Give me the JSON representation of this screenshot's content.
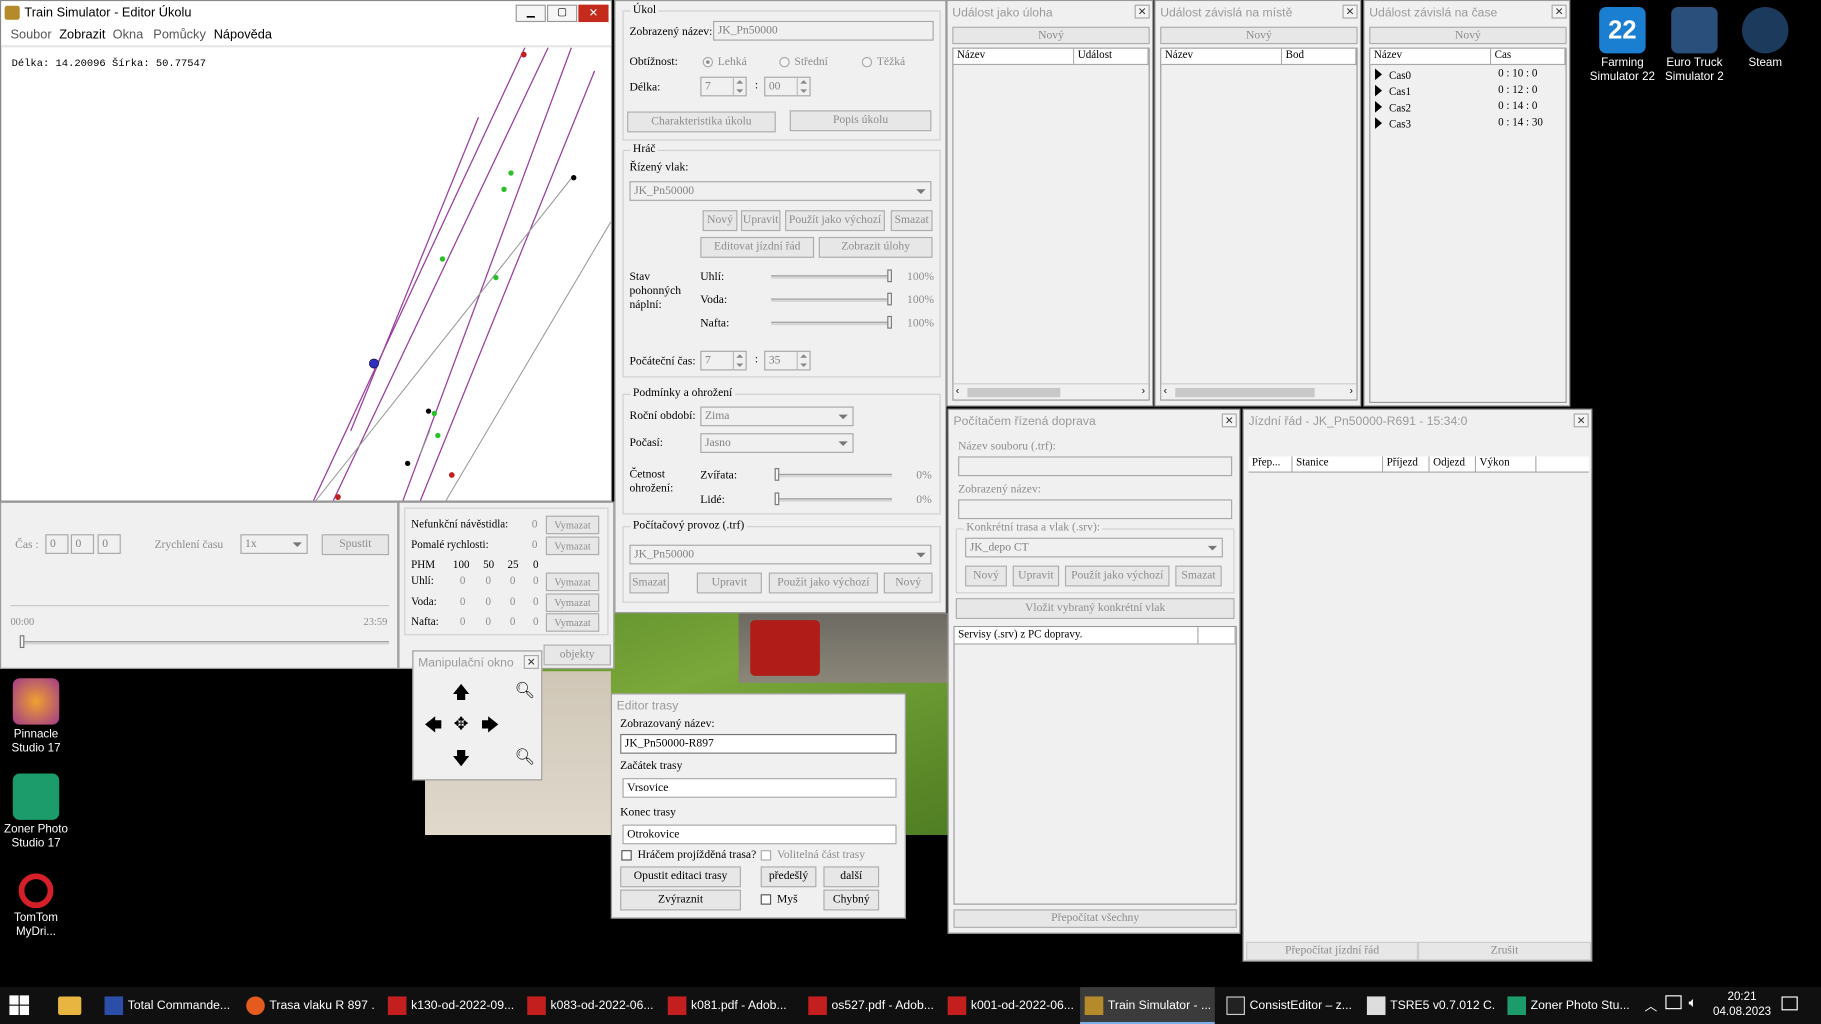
{
  "map_window": {
    "title": "Train Simulator - Editor Úkolu",
    "menu": [
      "Soubor",
      "Zobrazit",
      "Okna",
      "Pomůcky",
      "Nápověda"
    ],
    "coords": "Délka: 14.20096 Šírka: 50.77547"
  },
  "time_panel": {
    "cas_label": "Čas :",
    "h": "0",
    "m": "0",
    "s": "0",
    "zrychleni_label": "Zrychlení času",
    "zrychleni_value": "1x",
    "spustit": "Spustit",
    "t_start": "00:00",
    "t_end": "23:59"
  },
  "stats_panel": {
    "rows": [
      {
        "label": "Nefunkční návěstidla:",
        "vals": [
          "0"
        ],
        "btn": "Vymazat"
      },
      {
        "label": "Pomalé rychlosti:",
        "vals": [
          "0"
        ],
        "btn": "Vymazat"
      },
      {
        "label": "PHM",
        "vals": [
          "100",
          "50",
          "25",
          "0"
        ]
      },
      {
        "label": "Uhlí:",
        "vals": [
          "0",
          "0",
          "0",
          "0"
        ],
        "btn": "Vymazat"
      },
      {
        "label": "Voda:",
        "vals": [
          "0",
          "0",
          "0",
          "0"
        ],
        "btn": "Vymazat"
      },
      {
        "label": "Nafta:",
        "vals": [
          "0",
          "0",
          "0",
          "0"
        ],
        "btn": "Vymazat"
      }
    ],
    "objekty": "objekty"
  },
  "manip": {
    "title": "Manipulační okno"
  },
  "ukol": {
    "group": "Úkol",
    "zobr_label": "Zobrazený název:",
    "zobr_value": "JK_Pn50000",
    "obtiznost_label": "Obtížnost:",
    "obtiznost": [
      "Lehká",
      "Střední",
      "Těžká"
    ],
    "delka_label": "Délka:",
    "delka_h": "7",
    "delka_m": "00",
    "btn_char": "Charakteristika úkolu",
    "btn_popis": "Popis úkolu",
    "hrac_group": "Hráč",
    "rizeny_label": "Řízený vlak:",
    "rizeny_value": "JK_Pn50000",
    "btns1": [
      "Nový",
      "Upravit",
      "Použít jako výchozí",
      "Smazat"
    ],
    "btn_jr": "Editovat jízdní řád",
    "btn_ulohy": "Zobrazit úlohy",
    "stav_label": "Stav pohonných náplní:",
    "napln": [
      {
        "label": "Uhlí:",
        "value": "100%",
        "level": 1.0
      },
      {
        "label": "Voda:",
        "value": "100%",
        "level": 1.0
      },
      {
        "label": "Nafta:",
        "value": "100%",
        "level": 1.0
      }
    ],
    "pocatecni_label": "Počáteční čas:",
    "poc_h": "7",
    "poc_m": "35",
    "podminky_group": "Podmínky a ohrožení",
    "rocni_label": "Roční období:",
    "rocni_value": "Zima",
    "pocasi_label": "Počasí:",
    "pocasi_value": "Jasno",
    "cetnost_label": "Četnost ohrožení:",
    "ohrozeni": [
      {
        "label": "Zvířata:",
        "value": "0%",
        "level": 0
      },
      {
        "label": "Lidé:",
        "value": "0%",
        "level": 0
      }
    ],
    "provoz_group": "Počítačový provoz (.trf)",
    "provoz_value": "JK_Pn50000",
    "btns2": [
      "Smazat",
      "Upravit",
      "Použít jako výchozí",
      "Nový"
    ]
  },
  "uloha": {
    "title": "Událost jako úloha",
    "novy": "Nový",
    "cols": [
      "Název",
      "Událost"
    ]
  },
  "misto": {
    "title": "Událost závislá na místě",
    "novy": "Nový",
    "cols": [
      "Název",
      "Bod"
    ]
  },
  "cas": {
    "title": "Událost závislá na čase",
    "novy": "Nový",
    "cols": [
      "Název",
      "Cas"
    ],
    "rows": [
      {
        "name": "Cas0",
        "time": "0 : 10 : 0"
      },
      {
        "name": "Cas1",
        "time": "0 : 12 : 0"
      },
      {
        "name": "Cas2",
        "time": "0 : 14 : 0"
      },
      {
        "name": "Cas3",
        "time": "0 : 14 : 30"
      }
    ]
  },
  "pcd": {
    "title": "Počítačem řízená doprava",
    "soubor_label": "Název souboru (.trf):",
    "zobr_label": "Zobrazený název:",
    "konkretni_group": "Konkrétní trasa a vlak (.srv):",
    "konkretni_value": "JK_depo CT",
    "btns": [
      "Nový",
      "Upravit",
      "Použít jako výchozí",
      "Smazat"
    ],
    "vlozit": "Vložit vybraný konkrétní vlak",
    "servisy": "Servisy (.srv) z PC dopravy.",
    "prepocitat": "Přepočítat všechny"
  },
  "jr": {
    "title": "Jízdní řád - JK_Pn50000-R691 - 15:34:0",
    "cols": [
      "Přep...",
      "Stanice",
      "Příjezd",
      "Odjezd",
      "Výkon"
    ],
    "prepocitat": "Přepočítat jízdní řád",
    "zrusit": "Zrušit"
  },
  "trasa": {
    "title": "Editor trasy",
    "zobr_label": "Zobrazovaný název:",
    "zobr_value": "JK_Pn50000-R897",
    "zacatek_label": "Začátek trasy",
    "zacatek_value": "Vrsovice",
    "konec_label": "Konec trasy",
    "konec_value": "Otrokovice",
    "chk1": "Hráčem projížděná trasa?",
    "chk2": "Volitelná část trasy",
    "opustit": "Opustit editaci trasy",
    "predesly": "předešlý",
    "dalsi": "další",
    "zvyraznit": "Zvýraznit",
    "mys": "Myš",
    "chybny": "Chybný"
  },
  "desktop": {
    "right": [
      {
        "label": "Farming Simulator 22",
        "color": "#1a7fd0"
      },
      {
        "label": "Euro Truck Simulator 2",
        "color": "#2a4f7a"
      },
      {
        "label": "Steam",
        "color": "#1b3a5c"
      }
    ],
    "left": [
      {
        "label": "Pinnacle Studio 17",
        "color": "#a03a8a"
      },
      {
        "label": "Zoner Photo Studio 17",
        "color": "#1c9c6a"
      },
      {
        "label": "TomTom MyDri...",
        "color": "#d5202a"
      }
    ]
  },
  "taskbar": {
    "items": [
      "Total Commande...",
      "Trasa vlaku R 897 ...",
      "k130-od-2022-09...",
      "k083-od-2022-06...",
      "k081.pdf - Adob...",
      "os527.pdf - Adob...",
      "k001-od-2022-06...",
      "Train Simulator - ...",
      "ConsistEditor – z...",
      "TSRE5 v0.7.012 C...",
      "Zoner Photo Stu..."
    ],
    "time": "20:21",
    "date": "04.08.2023"
  }
}
